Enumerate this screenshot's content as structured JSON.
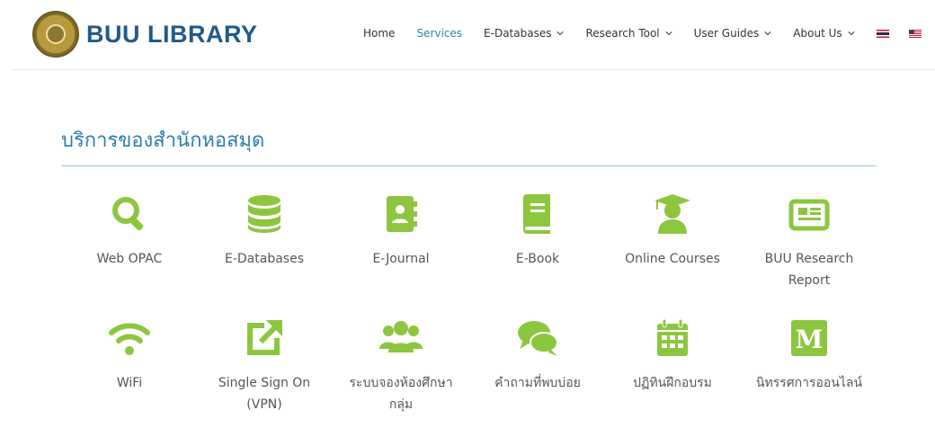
{
  "brand": {
    "name": "BUU LIBRARY"
  },
  "nav": {
    "home": "Home",
    "services": "Services",
    "databases": "E-Databases",
    "research": "Research Tool",
    "guides": "User Guides",
    "about": "About Us"
  },
  "section": {
    "title": "บริการของสำนักหอสมุด"
  },
  "services": [
    {
      "label": "Web OPAC",
      "icon": "search-icon"
    },
    {
      "label": "E-Databases",
      "icon": "database-icon"
    },
    {
      "label": "E-Journal",
      "icon": "address-book-icon"
    },
    {
      "label": "E-Book",
      "icon": "book-icon"
    },
    {
      "label": "Online Courses",
      "icon": "graduate-icon"
    },
    {
      "label": "BUU Research Report",
      "icon": "newspaper-icon"
    },
    {
      "label": "WiFi",
      "icon": "wifi-icon"
    },
    {
      "label": "Single Sign On (VPN)",
      "icon": "external-link-icon"
    },
    {
      "label": "ระบบจองห้องศึกษากลุ่ม",
      "icon": "users-icon"
    },
    {
      "label": "คำถามที่พบบ่อย",
      "icon": "comments-icon"
    },
    {
      "label": "ปฏิทินฝึกอบรม",
      "icon": "calendar-icon"
    },
    {
      "label": "นิทรรศการออนไลน์",
      "icon": "medium-icon"
    }
  ],
  "colors": {
    "icon": "#8cc63f",
    "accent": "#2a7eae",
    "brand": "#1f5a8c"
  }
}
